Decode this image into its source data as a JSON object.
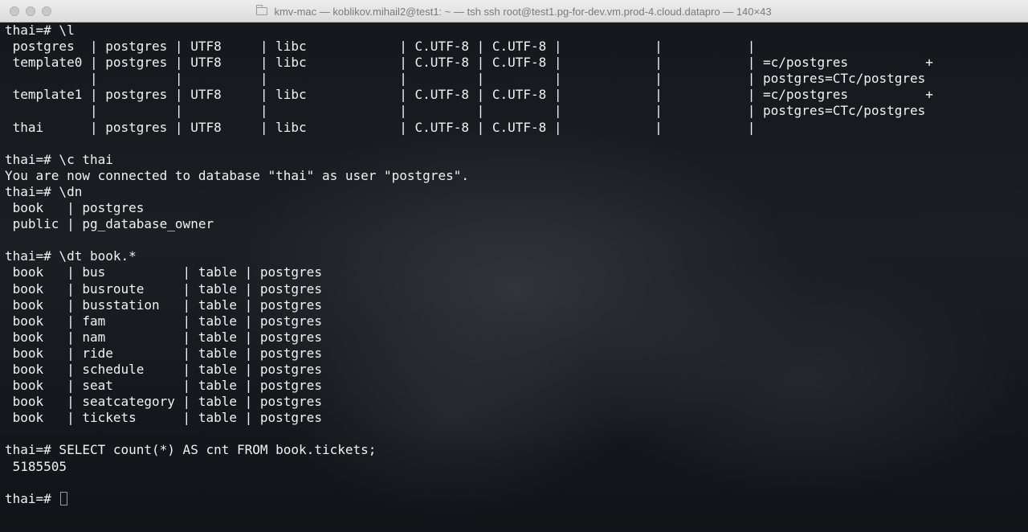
{
  "window": {
    "title": "kmv-mac — koblikov.mihail2@test1: ~ — tsh ssh root@test1.pg-for-dev.vm.prod-4.cloud.datapro — 140×43"
  },
  "terminal": {
    "lines": [
      "thai=# \\l",
      " postgres  | postgres | UTF8     | libc            | C.UTF-8 | C.UTF-8 |            |           |",
      " template0 | postgres | UTF8     | libc            | C.UTF-8 | C.UTF-8 |            |           | =c/postgres          +",
      "           |          |          |                 |         |         |            |           | postgres=CTc/postgres",
      " template1 | postgres | UTF8     | libc            | C.UTF-8 | C.UTF-8 |            |           | =c/postgres          +",
      "           |          |          |                 |         |         |            |           | postgres=CTc/postgres",
      " thai      | postgres | UTF8     | libc            | C.UTF-8 | C.UTF-8 |            |           |",
      "",
      "thai=# \\c thai",
      "You are now connected to database \"thai\" as user \"postgres\".",
      "thai=# \\dn",
      " book   | postgres",
      " public | pg_database_owner",
      "",
      "thai=# \\dt book.*",
      " book   | bus          | table | postgres",
      " book   | busroute     | table | postgres",
      " book   | busstation   | table | postgres",
      " book   | fam          | table | postgres",
      " book   | nam          | table | postgres",
      " book   | ride         | table | postgres",
      " book   | schedule     | table | postgres",
      " book   | seat         | table | postgres",
      " book   | seatcategory | table | postgres",
      " book   | tickets      | table | postgres",
      "",
      "thai=# SELECT count(*) AS cnt FROM book.tickets;",
      " 5185505",
      ""
    ],
    "prompt": "thai=# "
  }
}
